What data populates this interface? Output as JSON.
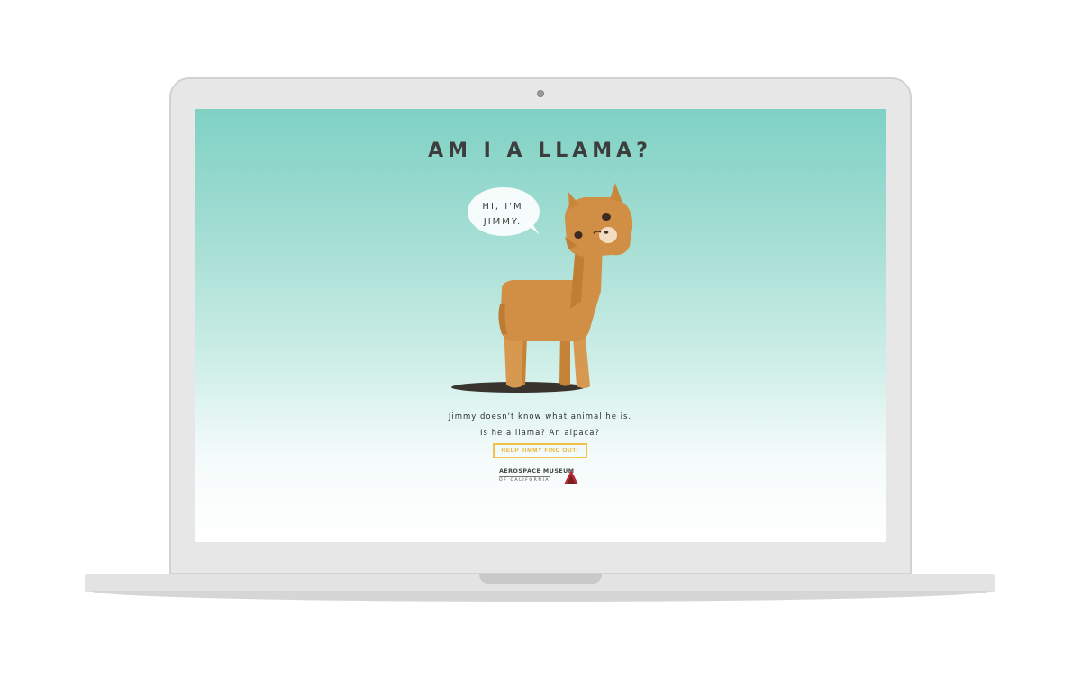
{
  "page": {
    "title": "AM I A LLAMA?",
    "speech_bubble": {
      "line1": "HI, I'M",
      "line2": "JIMMY."
    },
    "description_line1": "Jimmy doesn't know what animal he is.",
    "description_line2": "Is he a llama? An alpaca?",
    "cta_label": "HELP JIMMY FIND OUT!",
    "sponsor_logo": {
      "line1": "AEROSPACE MUSEUM",
      "line2": "OF CALIFORNIA"
    }
  },
  "colors": {
    "gradient_top": "#7fd1c4",
    "gradient_bottom": "#ffffff",
    "llama_body": "#d08f44",
    "cta_border": "#f2c14a",
    "title_text": "#3d3d3d"
  }
}
